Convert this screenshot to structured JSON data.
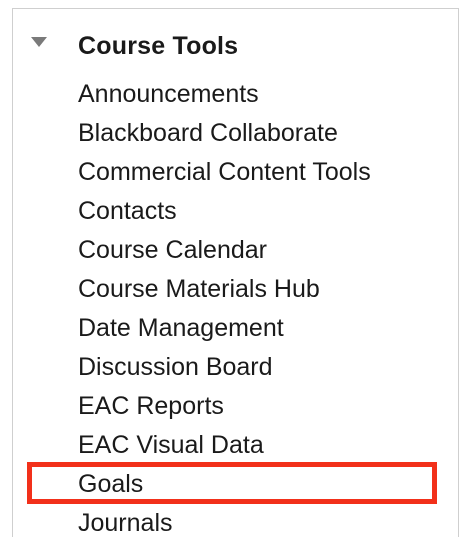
{
  "panel": {
    "title": "Course Tools",
    "items": [
      {
        "label": "Announcements"
      },
      {
        "label": "Blackboard Collaborate"
      },
      {
        "label": "Commercial Content Tools"
      },
      {
        "label": "Contacts"
      },
      {
        "label": "Course Calendar"
      },
      {
        "label": "Course Materials Hub"
      },
      {
        "label": "Date Management"
      },
      {
        "label": "Discussion Board"
      },
      {
        "label": "EAC Reports"
      },
      {
        "label": "EAC Visual Data"
      },
      {
        "label": "Goals"
      },
      {
        "label": "Journals"
      }
    ]
  },
  "colors": {
    "highlight": "#f2301a",
    "caret": "#7a7a7a"
  },
  "icons": {
    "caret": "caret-down-icon"
  }
}
